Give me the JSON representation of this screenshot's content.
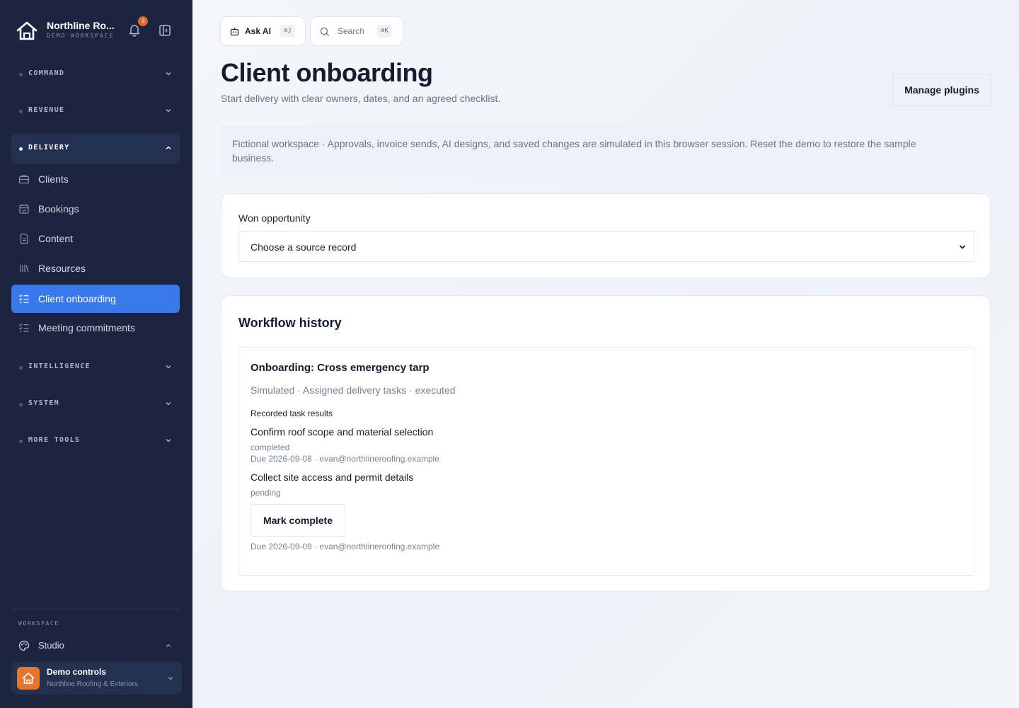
{
  "sidebar": {
    "brand_name": "Northline Ro...",
    "brand_sub": "DEMO WORKSPACE",
    "notification_count": "3",
    "sections": [
      {
        "label": "COMMAND"
      },
      {
        "label": "REVENUE"
      },
      {
        "label": "DELIVERY"
      },
      {
        "label": "INTELLIGENCE"
      },
      {
        "label": "SYSTEM"
      },
      {
        "label": "MORE TOOLS"
      }
    ],
    "items": [
      {
        "label": "Clients"
      },
      {
        "label": "Bookings"
      },
      {
        "label": "Content"
      },
      {
        "label": "Resources"
      },
      {
        "label": "Client onboarding"
      },
      {
        "label": "Meeting commitments"
      }
    ],
    "workspace_label": "WORKSPACE",
    "studio_label": "Studio",
    "demo_title": "Demo controls",
    "demo_sub": "Northline Roofing & Exteriors"
  },
  "topbar": {
    "ask_ai": "Ask AI",
    "ask_ai_kbd": "⌘J",
    "search": "Search",
    "search_kbd": "⌘K"
  },
  "page": {
    "title": "Client onboarding",
    "subtitle": "Start delivery with clear owners, dates, and an agreed checklist.",
    "manage_plugins": "Manage plugins",
    "notice": "Fictional workspace · Approvals, invoice sends, AI designs, and saved changes are simulated in this browser session. Reset the demo to restore the sample business."
  },
  "opportunity": {
    "label": "Won opportunity",
    "selected": "Choose a source record"
  },
  "history": {
    "heading": "Workflow history",
    "workflow_title": "Onboarding: Cross emergency tarp",
    "workflow_meta": "Simulated · Assigned delivery tasks · executed",
    "recorded_label": "Recorded task results",
    "tasks": [
      {
        "name": "Confirm roof scope and material selection",
        "status": "completed",
        "due": "Due 2026-09-08 · evan@northlineroofing.example"
      },
      {
        "name": "Collect site access and permit details",
        "status": "pending",
        "due": "Due 2026-09-09 · evan@northlineroofing.example",
        "action": "Mark complete"
      }
    ]
  },
  "colors": {
    "sidebar": "#1b2540",
    "accent": "#3a7ae8",
    "badge": "#e5622e",
    "avatar": "#e5762d"
  }
}
